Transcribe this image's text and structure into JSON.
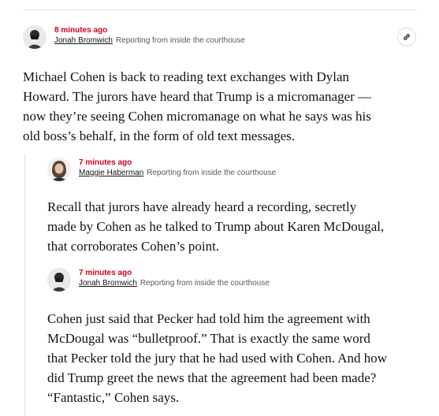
{
  "posts": [
    {
      "time": "8 minutes ago",
      "author": "Jonah Bromwich",
      "location": "Reporting from inside the courthouse",
      "lines": [
        "Michael Cohen is back to reading text exchanges with Dylan",
        "Howard. The jurors have heard that Trump is a micromanager —",
        "now they’re seeing Cohen micromanage on what he says was his",
        "old boss’s behalf, in the form of old text messages."
      ]
    },
    {
      "time": "7 minutes ago",
      "author": "Maggie Haberman",
      "location": "Reporting from inside the courthouse",
      "lines": [
        "Recall that jurors have already heard a recording, secretly",
        "made by Cohen as he talked to Trump about Karen McDougal,",
        "that corroborates Cohen’s point."
      ]
    },
    {
      "time": "7 minutes ago",
      "author": "Jonah Bromwich",
      "location": "Reporting from inside the courthouse",
      "lines": [
        "Cohen just said that Pecker had told him the agreement with",
        "McDougal was “bulletproof.” That is exactly the same word",
        "that Pecker told the jury that he had used with Cohen. And how",
        "did Trump greet the news that the agreement had been made?",
        "“Fantastic,” Cohen says."
      ]
    }
  ],
  "icons": {
    "share": "link-icon"
  }
}
